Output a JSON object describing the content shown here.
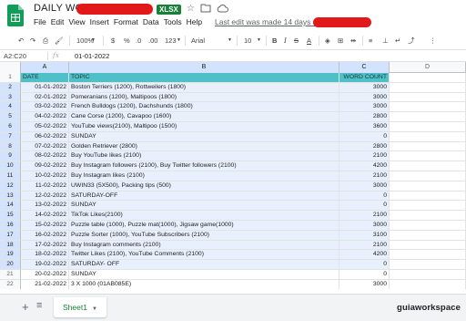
{
  "header": {
    "title": "DAILY WORK",
    "file_badge": "XLSX",
    "menu": [
      "File",
      "Edit",
      "View",
      "Insert",
      "Format",
      "Data",
      "Tools",
      "Help"
    ],
    "last_edit": "Last edit was made 14 days ago by",
    "colors": {
      "badge": "#188038",
      "redaction": "#e11919"
    }
  },
  "toolbar": {
    "zoom": "100%",
    "currency": "$",
    "percent": "%",
    "decimal_dec": ".0",
    "decimal_inc": ".00",
    "number_format": "123",
    "font": "Arial",
    "font_size": "10"
  },
  "formula_bar": {
    "name_box": "A2:C20",
    "fx": "fx",
    "value": "01-01-2022"
  },
  "columns": [
    "A",
    "B",
    "C",
    "D"
  ],
  "rows": [
    {
      "n": "1",
      "a": "DATE",
      "b": "TOPIC",
      "c": "WORD COUNT"
    },
    {
      "n": "2",
      "a": "01-01-2022",
      "b": "Boston Terriers (1200), Rottweilers (1800)",
      "c": "3000"
    },
    {
      "n": "3",
      "a": "02-01-2022",
      "b": "Pomeranians (1200), Maltipoos (1800)",
      "c": "3000"
    },
    {
      "n": "4",
      "a": "03-02-2022",
      "b": "French Bulldogs (1200), Dachshunds (1800)",
      "c": "3000"
    },
    {
      "n": "5",
      "a": "04-02-2022",
      "b": "Cane Corse (1200), Cavapoo (1600)",
      "c": "2800"
    },
    {
      "n": "6",
      "a": "05-02-2022",
      "b": "YouTube views(2100), Maltipoo (1500)",
      "c": "3600"
    },
    {
      "n": "7",
      "a": "06-02-2022",
      "b": "SUNDAY",
      "c": "0"
    },
    {
      "n": "8",
      "a": "07-02-2022",
      "b": "Golden Retriever (2800)",
      "c": "2800"
    },
    {
      "n": "9",
      "a": "08-02-2022",
      "b": "Buy YouTube likes (2100)",
      "c": "2100"
    },
    {
      "n": "10",
      "a": "09-02-2022",
      "b": "Buy Instagram followers (2100), Buy Twitter followers (2100)",
      "c": "4200"
    },
    {
      "n": "11",
      "a": "10-02-2022",
      "b": "Buy Instagram likes (2100)",
      "c": "2100"
    },
    {
      "n": "12",
      "a": "11-02-2022",
      "b": "UWIN33 (5X500), Packing tips (500)",
      "c": "3000"
    },
    {
      "n": "13",
      "a": "12-02-2022",
      "b": "SATURDAY-OFF",
      "c": "0"
    },
    {
      "n": "14",
      "a": "13-02-2022",
      "b": "SUNDAY",
      "c": "0"
    },
    {
      "n": "15",
      "a": "14-02-2022",
      "b": "TikTok Likes(2100)",
      "c": "2100"
    },
    {
      "n": "16",
      "a": "15-02-2022",
      "b": "Puzzle table (1000), Puzzle mat(1000), Jigsaw game(1000)",
      "c": "3000"
    },
    {
      "n": "17",
      "a": "16-02-2022",
      "b": "Puzzle Sorter (1000), YouTube Subscribers (2100)",
      "c": "3100"
    },
    {
      "n": "18",
      "a": "17-02-2022",
      "b": "Buy Instagram comments (2100)",
      "c": "2100"
    },
    {
      "n": "19",
      "a": "18-02-2022",
      "b": "Twitter Likes (2100), YouTube Comments (2100)",
      "c": "4200"
    },
    {
      "n": "20",
      "a": "19-02-2022",
      "b": "SATURDAY- OFF",
      "c": "0"
    },
    {
      "n": "21",
      "a": "20-02-2022",
      "b": "SUNDAY",
      "c": "0"
    },
    {
      "n": "22",
      "a": "21-02-2022",
      "b": "3 X 1000 (01AB085E)",
      "c": "3000"
    }
  ],
  "sheets": [
    "Sheet1"
  ],
  "watermark": "guiaworkspace"
}
